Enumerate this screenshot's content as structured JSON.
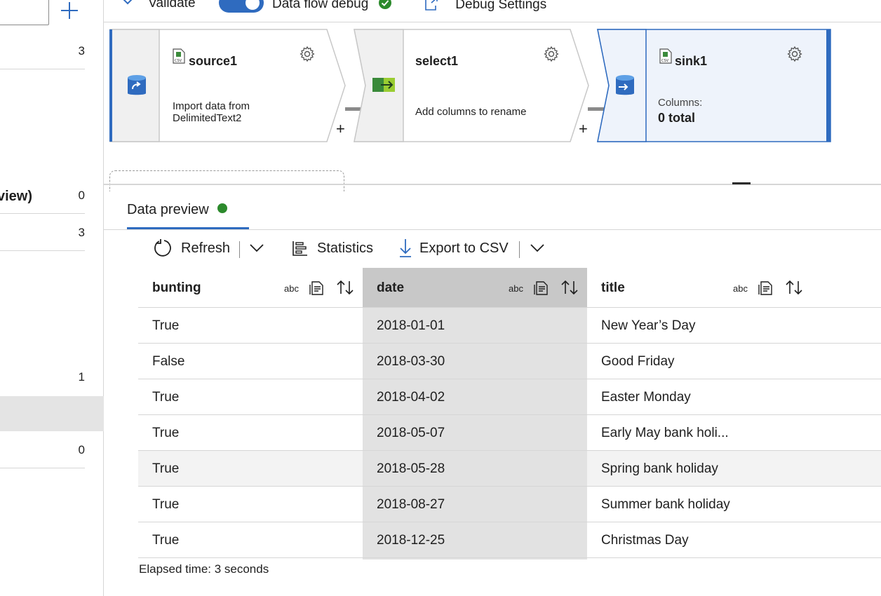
{
  "sidebar": {
    "rows": [
      {
        "label": "",
        "count": "3"
      },
      {
        "label": "view)",
        "count": "0"
      },
      {
        "label": "",
        "count": "3"
      },
      {
        "label": "",
        "count": "1"
      },
      {
        "label": "",
        "count": "0"
      }
    ]
  },
  "toolbar": {
    "validate_label": "Validate",
    "dataflow_debug_label": "Data flow debug",
    "debug_settings_label": "Debug Settings"
  },
  "nodes": {
    "source": {
      "title": "source1",
      "desc_line1": "Import data from",
      "desc_line2": "DelimitedText2"
    },
    "select": {
      "title": "select1",
      "desc": "Add columns to rename"
    },
    "sink": {
      "title": "sink1",
      "columns_label": "Columns:",
      "columns_value": "0 total"
    }
  },
  "preview": {
    "tab_label": "Data preview",
    "actions": {
      "refresh": "Refresh",
      "statistics": "Statistics",
      "export": "Export to CSV"
    },
    "columns": [
      {
        "name": "bunting",
        "type": "abc"
      },
      {
        "name": "date",
        "type": "abc"
      },
      {
        "name": "title",
        "type": "abc"
      }
    ],
    "rows": [
      [
        "True",
        "2018-01-01",
        "New Year’s Day"
      ],
      [
        "False",
        "2018-03-30",
        "Good Friday"
      ],
      [
        "True",
        "2018-04-02",
        "Easter Monday"
      ],
      [
        "True",
        "2018-05-07",
        "Early May bank holi..."
      ],
      [
        "True",
        "2018-05-28",
        "Spring bank holiday"
      ],
      [
        "True",
        "2018-08-27",
        "Summer bank holiday"
      ],
      [
        "True",
        "2018-12-25",
        "Christmas Day"
      ]
    ],
    "elapsed": "Elapsed time: 3 seconds"
  },
  "colors": {
    "accent": "#2f6bbf",
    "status_green": "#2c8a2c",
    "selected_node_fill": "#eef3fb"
  }
}
